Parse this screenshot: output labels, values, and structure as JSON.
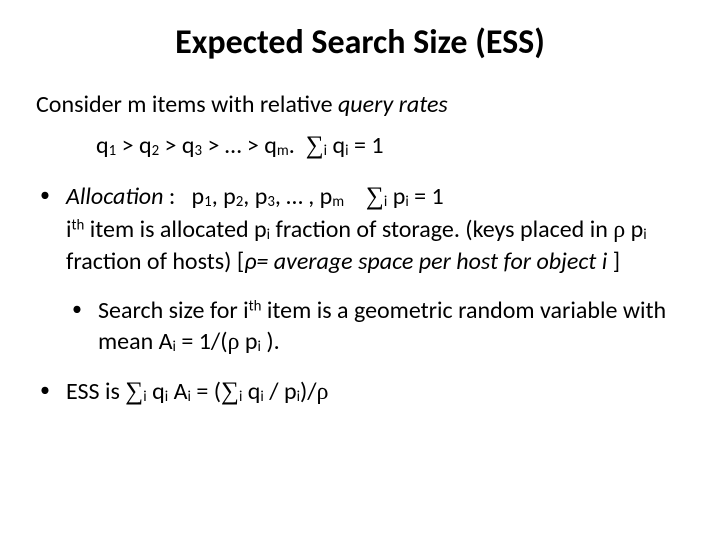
{
  "title": "Expected Search Size (ESS)",
  "intro": "Consider m items with relative ",
  "intro_italic": "query rates",
  "rates_line_a": "q",
  "rates_line_rel": " > q",
  "rates_line_dots": " > … > q",
  "rates_sum_eq": " = 1",
  "sigma": "∑",
  "sub_i": "i",
  "sub_m": "m",
  "sub_1": "1",
  "sub_2": "2",
  "sub_3": "3",
  "dot_end": ". ",
  "b1_label": "Allocation",
  "b1_colon": " :   p",
  "b1_list_sep": ", p",
  "b1_dots": ", … , p",
  "b1_sum_eq": " = 1",
  "b1_line2a": "i",
  "b1_line2b": " item is allocated p",
  "b1_line2c": " fraction of storage. (keys placed in ",
  "b1_line2d": " p",
  "b1_line2e": " fraction of hosts) [",
  "b1_line2f": "ρ= average space per host for object i ",
  "b1_line2g": "]",
  "sup_th": "th",
  "rho": "ρ",
  "b2_a": "Search size for i",
  "b2_b": " item is a geometric random variable with mean A",
  "b2_c": " = 1/(",
  "b2_d": " p",
  "b2_e": " ).",
  "b3_a": "ESS is ",
  "b3_b": " q",
  "b3_c": " A",
  "b3_d": " = (",
  "b3_e": " q",
  "b3_f": " / p",
  "b3_g": ")/",
  "bullet": "•"
}
